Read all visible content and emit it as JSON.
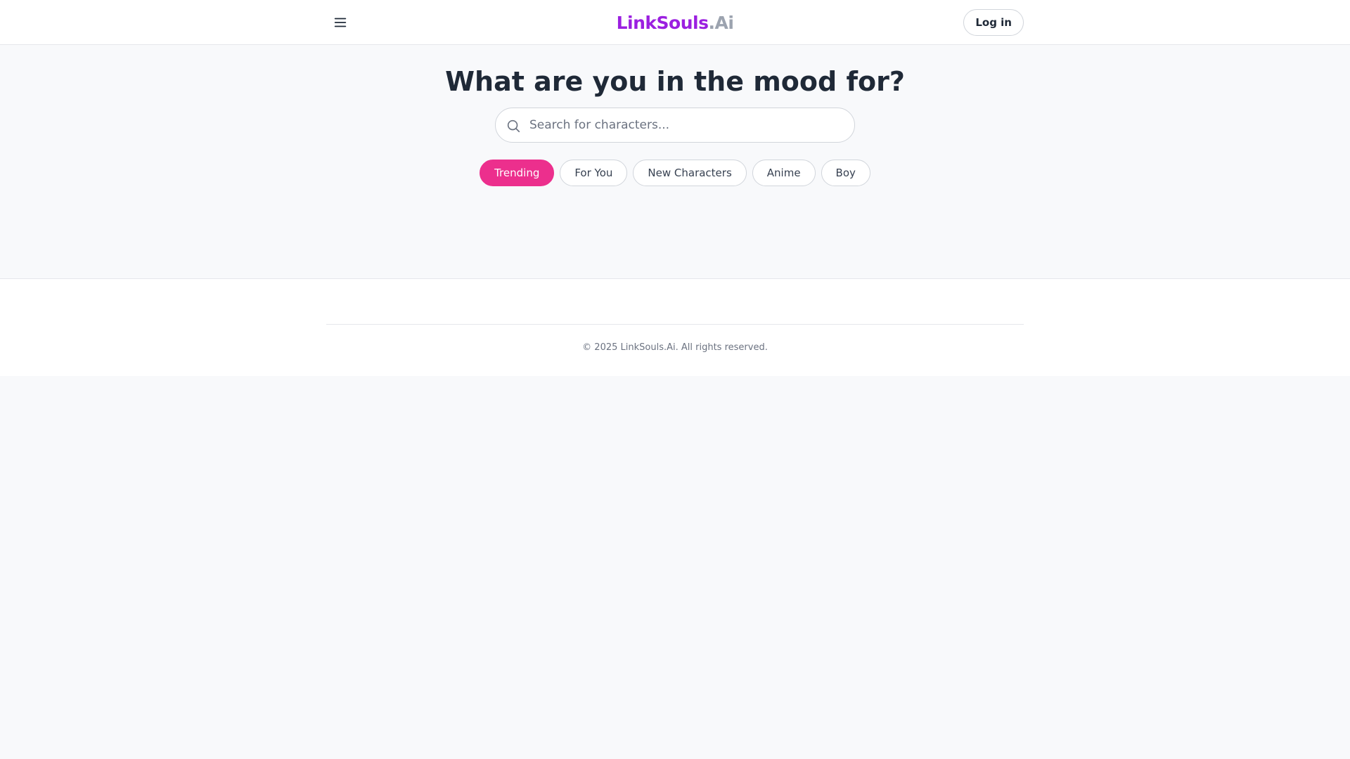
{
  "header": {
    "logo_brand": "LinkSouls",
    "logo_suffix": ".Ai",
    "login_label": "Log in"
  },
  "hero": {
    "title": "What are you in the mood for?"
  },
  "search": {
    "placeholder": "Search for characters..."
  },
  "categories": [
    {
      "label": "Trending",
      "active": true
    },
    {
      "label": "For You",
      "active": false
    },
    {
      "label": "New Characters",
      "active": false
    },
    {
      "label": "Anime",
      "active": false
    },
    {
      "label": "Boy",
      "active": false
    }
  ],
  "footer": {
    "copyright": "© 2025 LinkSouls.Ai. All rights reserved."
  },
  "colors": {
    "brand_purple": "#9b1fe0",
    "accent_pink": "#ec2f8d",
    "suffix_gray": "#9ca3af"
  },
  "icons": {
    "menu": "hamburger-menu-icon",
    "search": "search-icon"
  }
}
